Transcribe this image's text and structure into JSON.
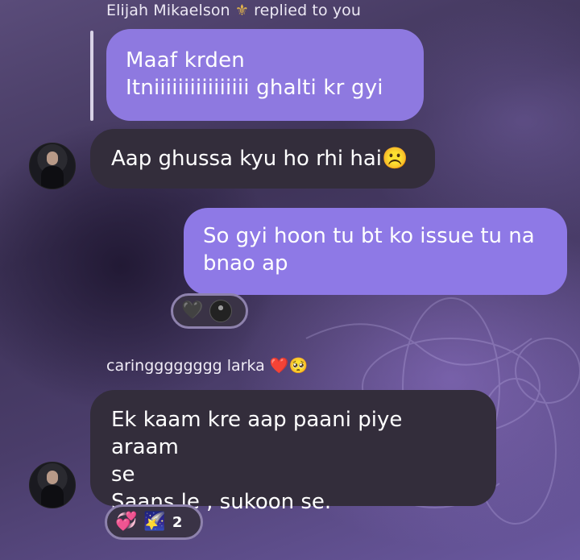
{
  "reply_header": {
    "sender": "Elijah Mikaelson",
    "emoji": "⚜",
    "suffix": "replied to you"
  },
  "quoted_message": {
    "line1": "Maaf krden",
    "line2": "Itniiiiiiiiiiiiiiii ghalti kr gyi"
  },
  "messages": [
    {
      "text": "Aap ghussa kyu ho rhi hai☹️"
    },
    {
      "text_line1": "So gyi hoon tu bt ko issue tu na",
      "text_line2": "bnao ap"
    },
    {
      "line1": "Ek kaam kre aap paani piye araam",
      "line2": "se",
      "line3": "Saans le , sukoon se."
    }
  ],
  "reactions": {
    "first": {
      "emoji": "🖤"
    },
    "second": {
      "emoji1": "💞",
      "emoji2": "🌠",
      "count": "2"
    }
  },
  "sender_label": "caringggggggg larka ❤️🥺",
  "colors": {
    "purple_bubble": "#8e79e6",
    "dark_bubble": "#332d3b",
    "quoted_bubble": "#8e79e0"
  }
}
